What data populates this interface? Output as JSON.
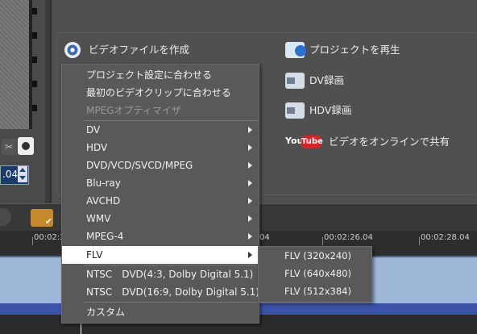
{
  "actions": {
    "create_video": "ビデオファイルを作成",
    "play_project": "プロジェクトを再生",
    "dv_record": "DV録画",
    "hdv_record": "HDV録画",
    "share_online": "ビデオをオンラインで共有",
    "youtube_you": "You",
    "youtube_tube": "Tube"
  },
  "frame_spinner": ".04",
  "timeline": {
    "timecodes": [
      "00:02:2",
      "04",
      "00:02:26.04",
      "00:02:28.04"
    ]
  },
  "menu": {
    "items": [
      {
        "label": "プロジェクト設定に合わせる",
        "enabled": true,
        "submenu": false
      },
      {
        "label": "最初のビデオクリップに合わせる",
        "enabled": true,
        "submenu": false
      },
      {
        "label": "MPEGオプティマイザ",
        "enabled": false,
        "submenu": false
      },
      {
        "label": "DV",
        "enabled": true,
        "submenu": true
      },
      {
        "label": "HDV",
        "enabled": true,
        "submenu": true
      },
      {
        "label": "DVD/VCD/SVCD/MPEG",
        "enabled": true,
        "submenu": true
      },
      {
        "label": "Blu-ray",
        "enabled": true,
        "submenu": true
      },
      {
        "label": "AVCHD",
        "enabled": true,
        "submenu": true
      },
      {
        "label": "WMV",
        "enabled": true,
        "submenu": true
      },
      {
        "label": "MPEG-4",
        "enabled": true,
        "submenu": true
      },
      {
        "label": "FLV",
        "enabled": true,
        "submenu": true,
        "selected": true
      },
      {
        "label": "NTSC　DVD(4:3, Dolby Digital 5.1)",
        "enabled": true,
        "submenu": false
      },
      {
        "label": "NTSC　DVD(16:9, Dolby Digital 5.1)",
        "enabled": true,
        "submenu": false
      },
      {
        "label": "カスタム",
        "enabled": true,
        "submenu": false
      }
    ]
  },
  "submenu": {
    "items": [
      "FLV (320x240)",
      "FLV (640x480)",
      "FLV (512x384)"
    ]
  }
}
